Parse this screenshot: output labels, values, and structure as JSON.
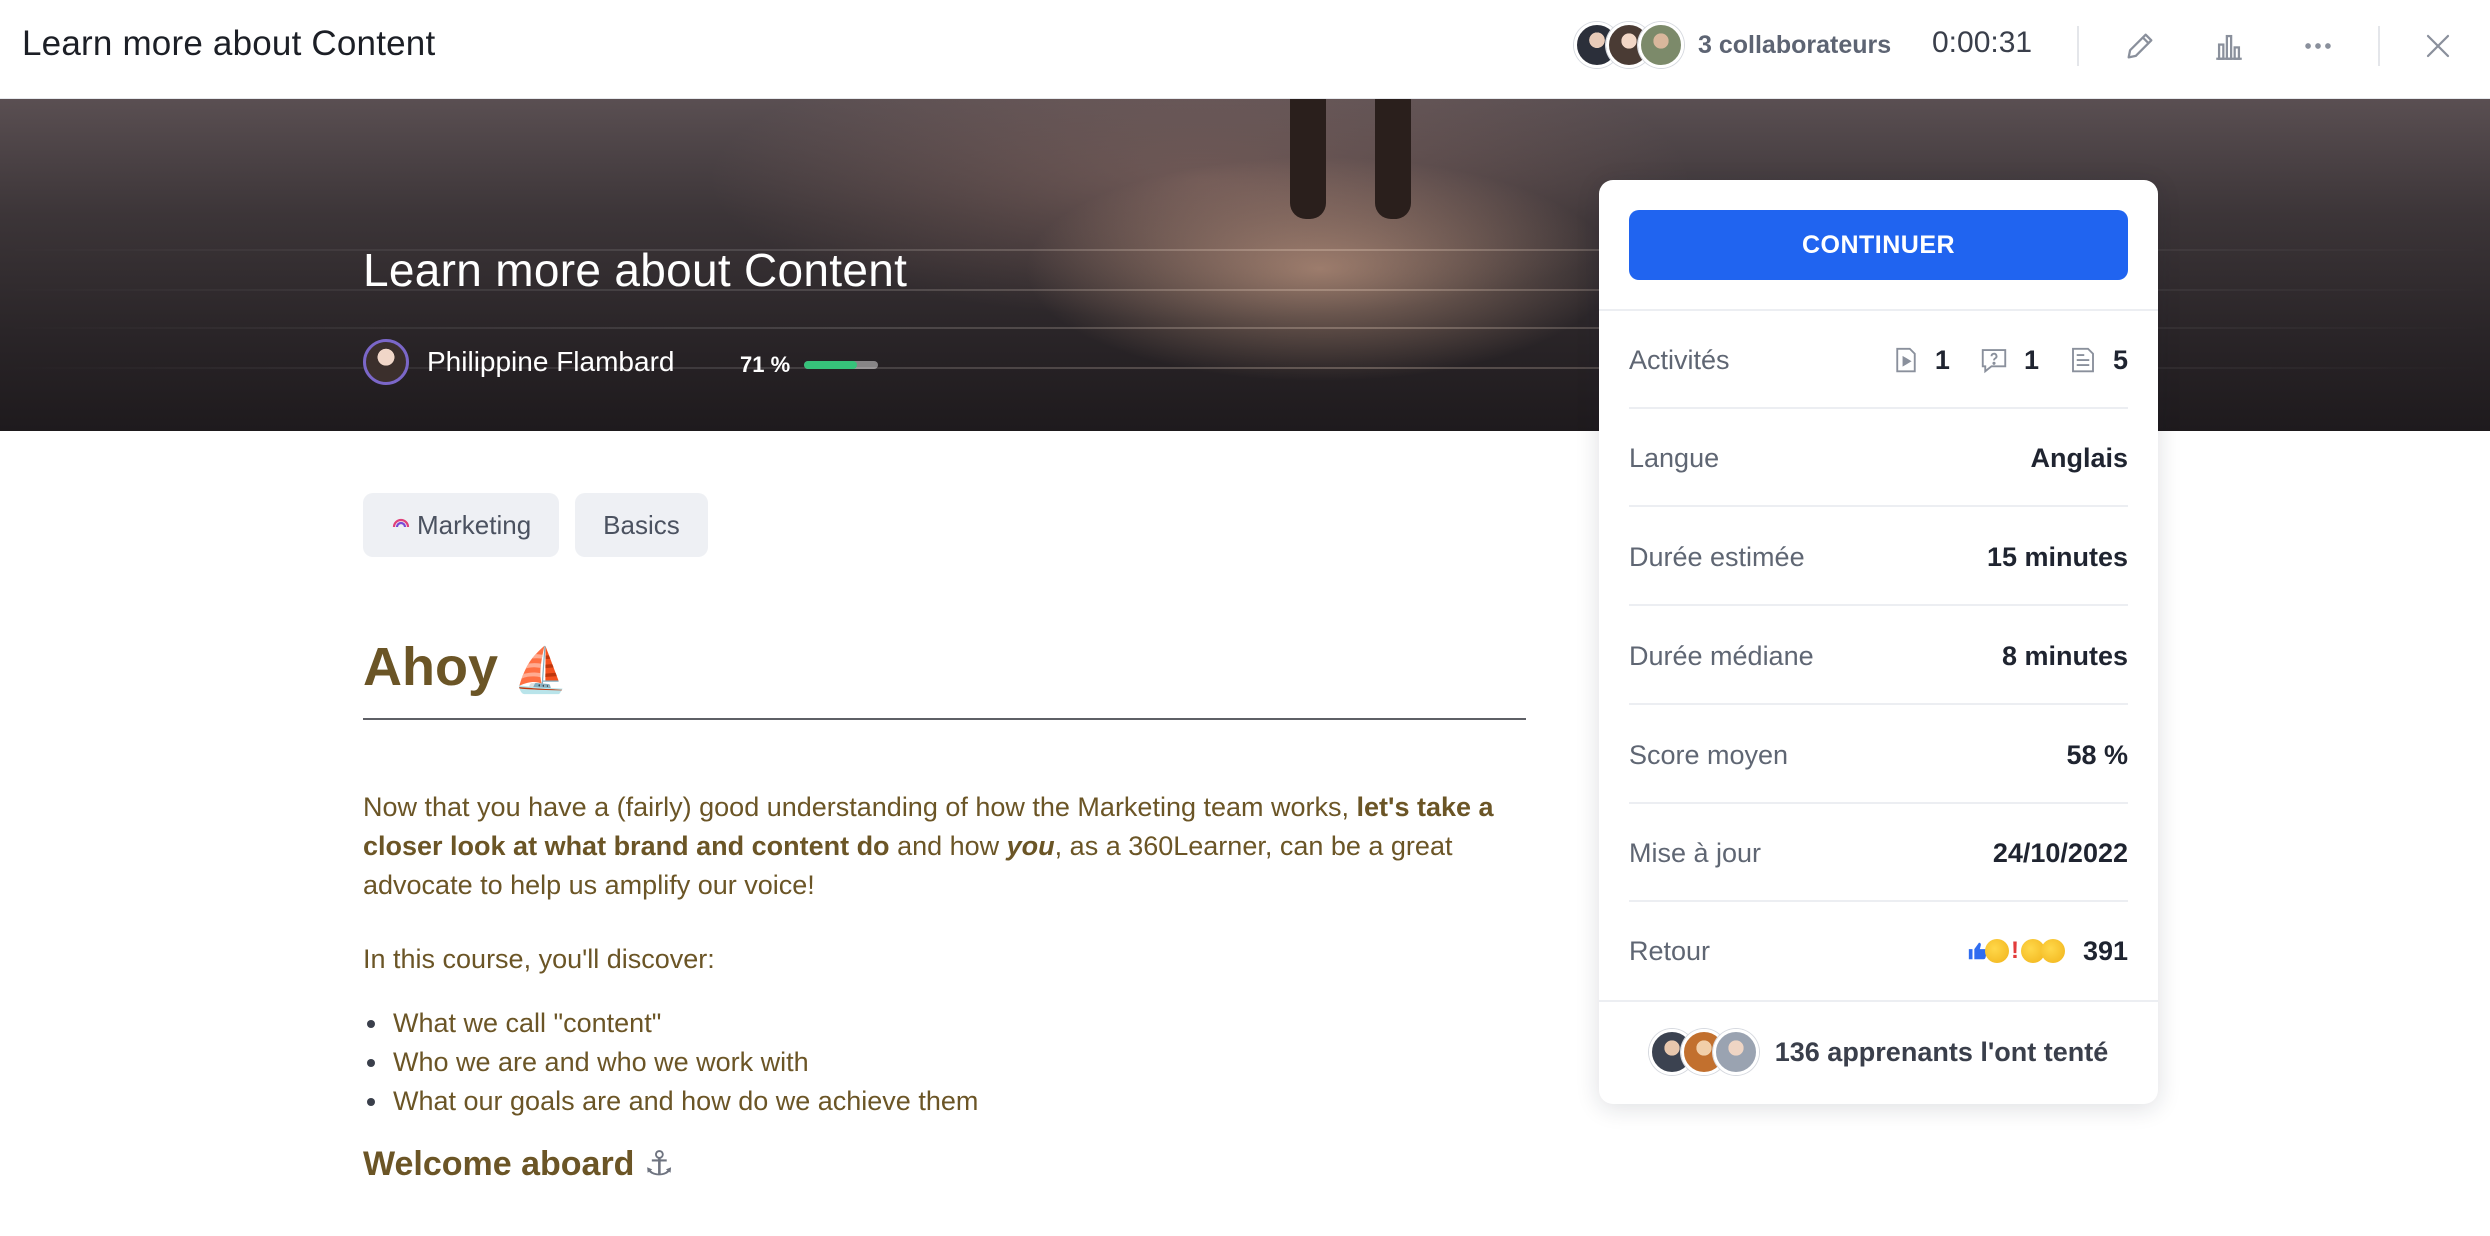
{
  "header": {
    "title": "Learn more about Content",
    "collaborators_label": "3 collaborateurs",
    "timer": "0:00:31",
    "icons": [
      "pencil-icon",
      "bar-chart-icon",
      "more-icon",
      "close-icon"
    ]
  },
  "hero": {
    "title": "Learn more about Content",
    "author": "Philippine Flambard",
    "progress_label": "71 %",
    "progress_value": 0.71,
    "progress_color": "#36c27a"
  },
  "tags": [
    {
      "label": "Marketing",
      "icon": "rainbow-icon"
    },
    {
      "label": "Basics"
    }
  ],
  "content": {
    "heading": "Ahoy",
    "heading_emoji": "⛵",
    "para_part1": "Now that you have a (fairly) good understanding of how the Marketing team works, ",
    "para_bold": "let's take a closer look at what brand and content do",
    "para_part2": " and how ",
    "para_italic": "you",
    "para_part3": ", as a 360Learner, can be a great advocate to help us amplify our voice!",
    "intro": "In this course, you'll discover:",
    "bullets": [
      "What we call \"content\"",
      "Who we are and who we work with",
      "What our goals are and how do we achieve them"
    ],
    "subheading": "Welcome aboard",
    "subheading_emoji": "⚓"
  },
  "card": {
    "cta_label": "CONTINUER",
    "cta_color": "#2064f0",
    "activities_label": "Activités",
    "activities": [
      {
        "icon": "video-icon",
        "count": "1"
      },
      {
        "icon": "question-icon",
        "count": "1"
      },
      {
        "icon": "text-icon",
        "count": "5"
      }
    ],
    "rows": [
      {
        "label": "Langue",
        "value": "Anglais"
      },
      {
        "label": "Durée estimée",
        "value": "15 minutes"
      },
      {
        "label": "Durée médiane",
        "value": "8 minutes"
      },
      {
        "label": "Score moyen",
        "value": "58 %"
      },
      {
        "label": "Mise à jour",
        "value": "24/10/2022"
      }
    ],
    "feedback_label": "Retour",
    "feedback_count": "391",
    "learners_label": "136 apprenants l'ont tenté"
  }
}
